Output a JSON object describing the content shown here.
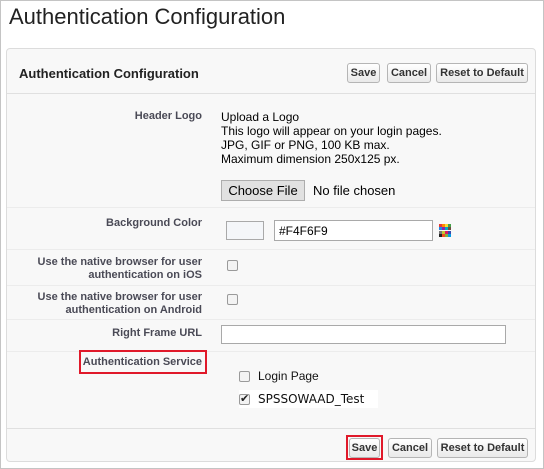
{
  "page": {
    "title": "Authentication Configuration"
  },
  "panel": {
    "title": "Authentication Configuration",
    "buttons": {
      "save": "Save",
      "cancel": "Cancel",
      "reset": "Reset to Default"
    }
  },
  "fields": {
    "header_logo": {
      "label": "Header Logo",
      "lines": [
        "Upload a Logo",
        "This logo will appear on your login pages.",
        "JPG, GIF or PNG, 100 KB max.",
        "Maximum dimension 250x125 px."
      ],
      "choose_label": "Choose File",
      "file_status": "No file chosen"
    },
    "background_color": {
      "label": "Background Color",
      "value": "#F4F6F9",
      "swatch_color": "#F4F6F9"
    },
    "native_ios": {
      "label_line1": "Use the native browser for user",
      "label_line2": "authentication on iOS"
    },
    "native_android": {
      "label_line1": "Use the native browser for user",
      "label_line2": "authentication on Android"
    },
    "right_frame_url": {
      "label": "Right Frame URL",
      "value": ""
    },
    "auth_service": {
      "label": "Authentication Service",
      "options": [
        {
          "label": "Login Page",
          "checked": false
        },
        {
          "label": "SPSSOWAAD_Test",
          "checked": true
        }
      ]
    }
  },
  "colors": {
    "highlight": "#e0192a"
  },
  "icons": {
    "color_picker": "color-picker-icon",
    "check": "checkmark-icon"
  }
}
